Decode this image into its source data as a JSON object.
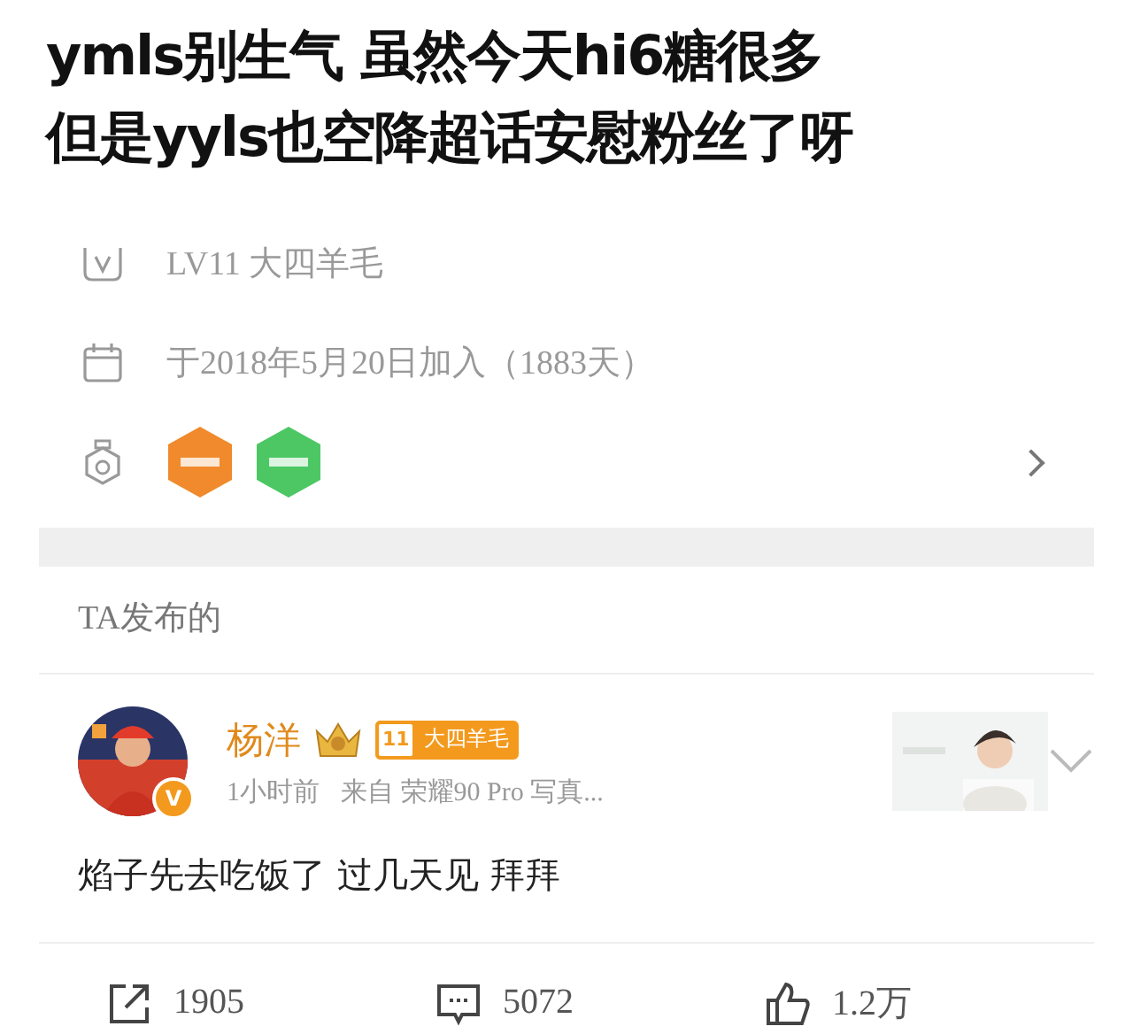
{
  "caption": {
    "lines": [
      "ymls别生气 虽然今天hi6糖很多",
      "但是yyls也空降超话安慰粉丝了呀"
    ]
  },
  "profile": {
    "level_text": "LV11 大四羊毛",
    "joined_text": "于2018年5月20日加入（1883天）",
    "badges": [
      {
        "color": "#f08a2c"
      },
      {
        "color": "#4cc764"
      }
    ]
  },
  "section_title": "TA发布的",
  "post": {
    "author": "杨洋",
    "level_badge": {
      "number": "11",
      "label": "大四羊毛"
    },
    "verified": "V",
    "time": "1小时前",
    "source": "来自  荣耀90 Pro 写真...",
    "text": "焰子先去吃饭了 过几天见 拜拜",
    "actions": [
      {
        "kind": "repost",
        "count": "1905"
      },
      {
        "kind": "comment",
        "count": "5072"
      },
      {
        "kind": "like",
        "count": "1.2万"
      }
    ]
  }
}
